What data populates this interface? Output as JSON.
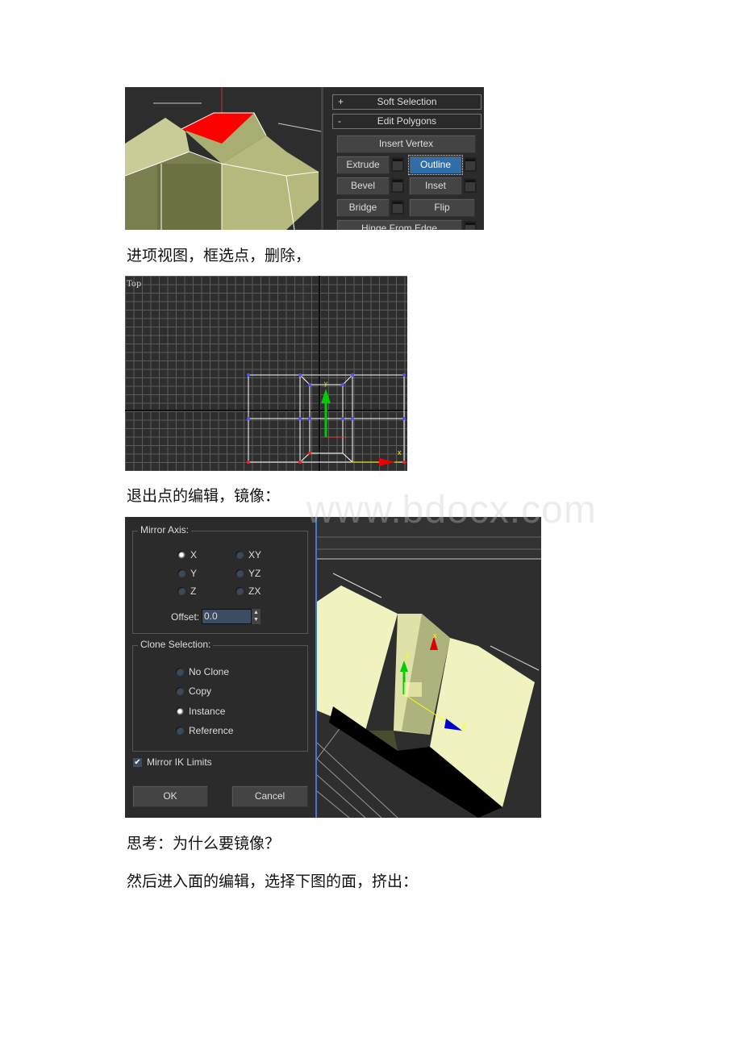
{
  "paragraphs": [
    "进项视图，框选点，删除，",
    "退出点的编辑，镜像：",
    "思考：为什么要镜像？",
    "然后进入面的编辑，选择下图的面，挤出："
  ],
  "watermark": "www.bdocx.com",
  "panel1": {
    "rollouts": [
      {
        "sign": "+",
        "label": "Soft Selection"
      },
      {
        "sign": "-",
        "label": "Edit Polygons"
      }
    ],
    "buttons": {
      "insert_vertex": "Insert Vertex",
      "extrude": "Extrude",
      "outline": "Outline",
      "bevel": "Bevel",
      "inset": "Inset",
      "bridge": "Bridge",
      "flip": "Flip",
      "hinge": "Hinge From Edge"
    },
    "active_button": "Outline",
    "selected_face_color": "#ff0000"
  },
  "viewport_top": {
    "label": "Top",
    "axis_x": "x",
    "axis_y": "y"
  },
  "mirror_dialog": {
    "mirror_axis_label": "Mirror Axis:",
    "axes": [
      "X",
      "Y",
      "Z",
      "XY",
      "YZ",
      "ZX"
    ],
    "selected_axis": "X",
    "offset_label": "Offset:",
    "offset_value": "0.0",
    "clone_label": "Clone Selection:",
    "clone_options": [
      "No Clone",
      "Copy",
      "Instance",
      "Reference"
    ],
    "selected_clone": "Instance",
    "mirror_ik_label": "Mirror IK Limits",
    "mirror_ik_checked": true,
    "ok": "OK",
    "cancel": "Cancel"
  },
  "viewport_persp": {
    "axis_x": "x",
    "axis_y": "y",
    "axis_z": "z"
  }
}
